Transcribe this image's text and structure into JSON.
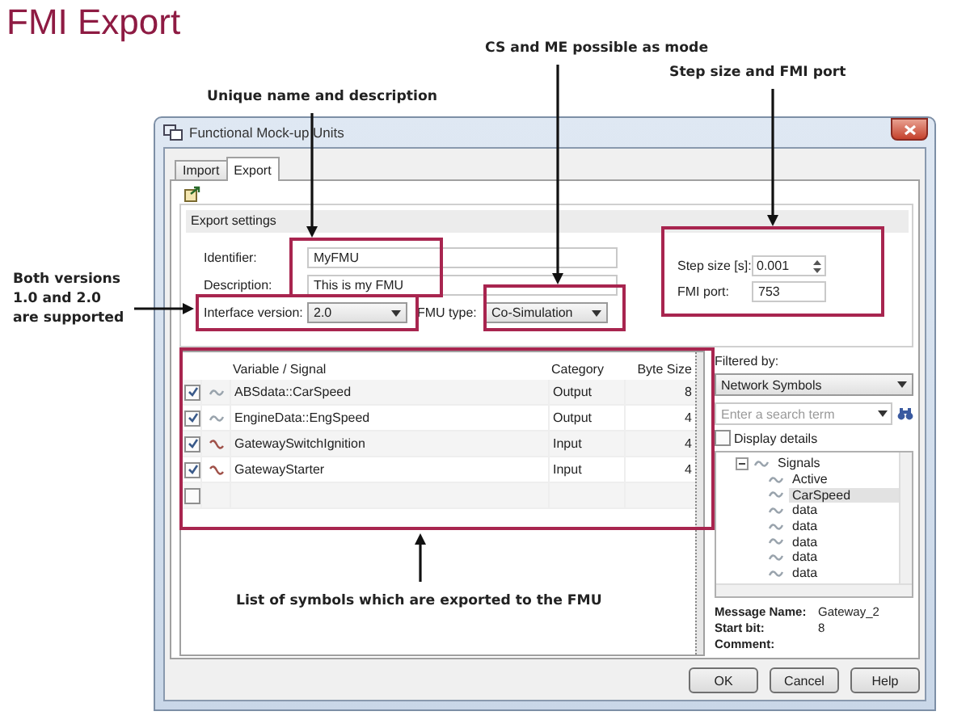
{
  "title": "FMI Export",
  "annotations": [
    "Unique name and description",
    "CS and ME possible as mode",
    "Step size and FMI port",
    "Both versions 1.0 and 2.0 are supported",
    "List of symbols which are exported to the FMU"
  ],
  "dialog": {
    "title": "Functional Mock-up Units",
    "tabs": [
      {
        "label": "Import",
        "selected": false
      },
      {
        "label": "Export",
        "selected": true
      }
    ],
    "export_settings": {
      "header": "Export settings",
      "identifier": {
        "label": "Identifier:",
        "value": "MyFMU"
      },
      "description": {
        "label": "Description:",
        "value": "This is my FMU"
      },
      "interface_version": {
        "label": "Interface version:",
        "value": "2.0"
      },
      "fmu_type": {
        "label": "FMU type:",
        "value": "Co-Simulation"
      },
      "step_size": {
        "label": "Step size [s]:",
        "value": "0.001"
      },
      "fmi_port": {
        "label": "FMI port:",
        "value": "753"
      }
    },
    "signal_table": {
      "columns": [
        "Variable / Signal",
        "Category",
        "Byte Size"
      ],
      "rows": [
        {
          "checked": true,
          "kind": "output",
          "name": "ABSdata::CarSpeed",
          "category": "Output",
          "byte_size": "8"
        },
        {
          "checked": true,
          "kind": "output",
          "name": "EngineData::EngSpeed",
          "category": "Output",
          "byte_size": "4"
        },
        {
          "checked": true,
          "kind": "input",
          "name": "GatewaySwitchIgnition",
          "category": "Input",
          "byte_size": "4"
        },
        {
          "checked": true,
          "kind": "input",
          "name": "GatewayStarter",
          "category": "Input",
          "byte_size": "4"
        },
        {
          "checked": false,
          "kind": "empty"
        }
      ]
    },
    "symbol_panel": {
      "filter_label": "Filtered by:",
      "filter": "Network Symbols",
      "search": {
        "placeholder": "Enter a search term"
      },
      "display_details": {
        "label": "Display details",
        "checked": false
      },
      "tree": [
        {
          "label": "Signals",
          "expanded": true,
          "selected": false,
          "children": [
            {
              "label": "Active",
              "selected": false
            },
            {
              "label": "CarSpeed",
              "selected": true
            },
            {
              "label": "data",
              "selected": false
            },
            {
              "label": "data",
              "selected": false
            },
            {
              "label": "data",
              "selected": false
            },
            {
              "label": "data",
              "selected": false
            },
            {
              "label": "data",
              "selected": false
            }
          ]
        }
      ],
      "details": [
        {
          "label": "Message Name:",
          "value": "Gateway_2"
        },
        {
          "label": "Start bit:",
          "value": "8"
        },
        {
          "label": "Comment:"
        }
      ]
    },
    "buttons": [
      "OK",
      "Cancel",
      "Help"
    ]
  }
}
